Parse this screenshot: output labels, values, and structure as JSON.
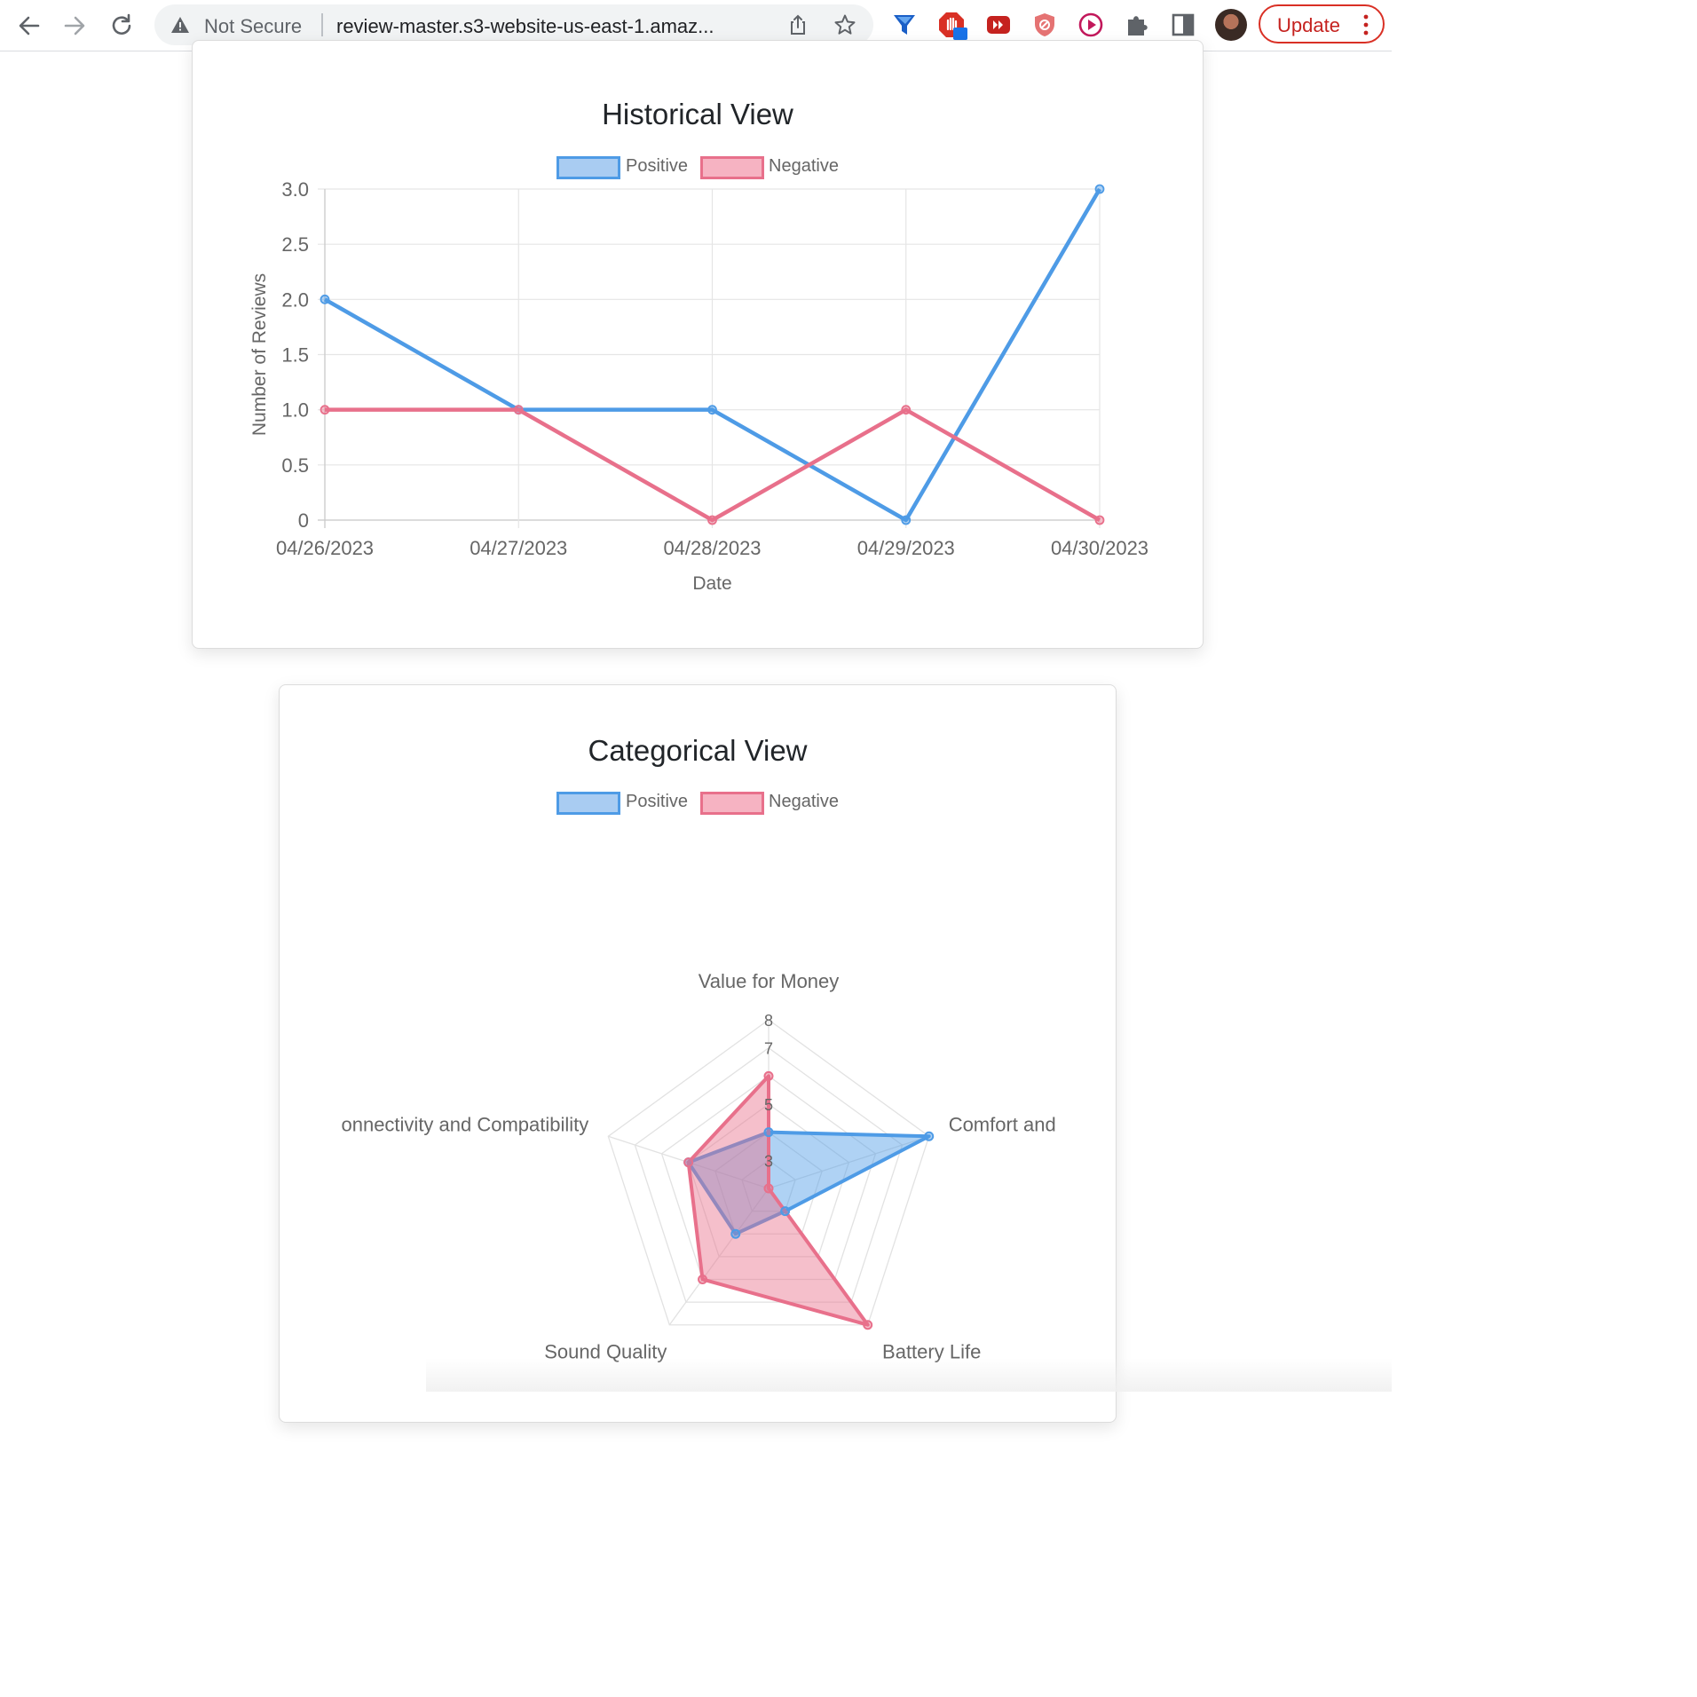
{
  "browser": {
    "security_label": "Not Secure",
    "url": "review-master.s3-website-us-east-1.amaz...",
    "update_label": "Update",
    "extension_icons": [
      "funnel-extension-icon",
      "adblock-extension-icon",
      "video-extension-icon",
      "shield-extension-icon",
      "play-extension-icon",
      "puzzle-extensions-icon",
      "side-panel-icon"
    ]
  },
  "colors": {
    "positive": "#4e9be6",
    "negative": "#e8708b",
    "update_accent": "#d93025"
  },
  "historical": {
    "title": "Historical View",
    "legend": [
      "Positive",
      "Negative"
    ]
  },
  "categorical": {
    "title": "Categorical View",
    "legend": [
      "Positive",
      "Negative"
    ],
    "axis_labels_visible": [
      "Value for Money",
      "Comfort and",
      "Battery Life",
      "Sound Quality",
      "onnectivity and Compatibility"
    ],
    "tick_labels_visible": [
      "8",
      "7",
      "5",
      "3"
    ]
  },
  "chart_data": [
    {
      "type": "line",
      "title": "Historical View",
      "xlabel": "Date",
      "ylabel": "Number of Reviews",
      "categories": [
        "04/26/2023",
        "04/27/2023",
        "04/28/2023",
        "04/29/2023",
        "04/30/2023"
      ],
      "yticks": [
        "0",
        "0.5",
        "1.0",
        "1.5",
        "2.0",
        "2.5",
        "3.0"
      ],
      "ylim": [
        0,
        3
      ],
      "grid": true,
      "legend_position": "top",
      "series": [
        {
          "name": "Positive",
          "values": [
            2,
            1,
            1,
            0,
            3
          ]
        },
        {
          "name": "Negative",
          "values": [
            1,
            1,
            0,
            1,
            0
          ]
        }
      ]
    },
    {
      "type": "radar",
      "title": "Categorical View",
      "categories": [
        "Value for Money",
        "Comfort and",
        "Battery Life",
        "Sound Quality",
        "onnectivity and Compatibility"
      ],
      "rlim": [
        2,
        8
      ],
      "ticks": [
        3,
        4,
        5,
        6,
        7,
        8
      ],
      "grid": true,
      "legend_position": "top",
      "series": [
        {
          "name": "Positive",
          "values": [
            4,
            8,
            3,
            4,
            5
          ]
        },
        {
          "name": "Negative",
          "values": [
            6,
            2,
            8,
            6,
            5
          ]
        }
      ]
    }
  ]
}
